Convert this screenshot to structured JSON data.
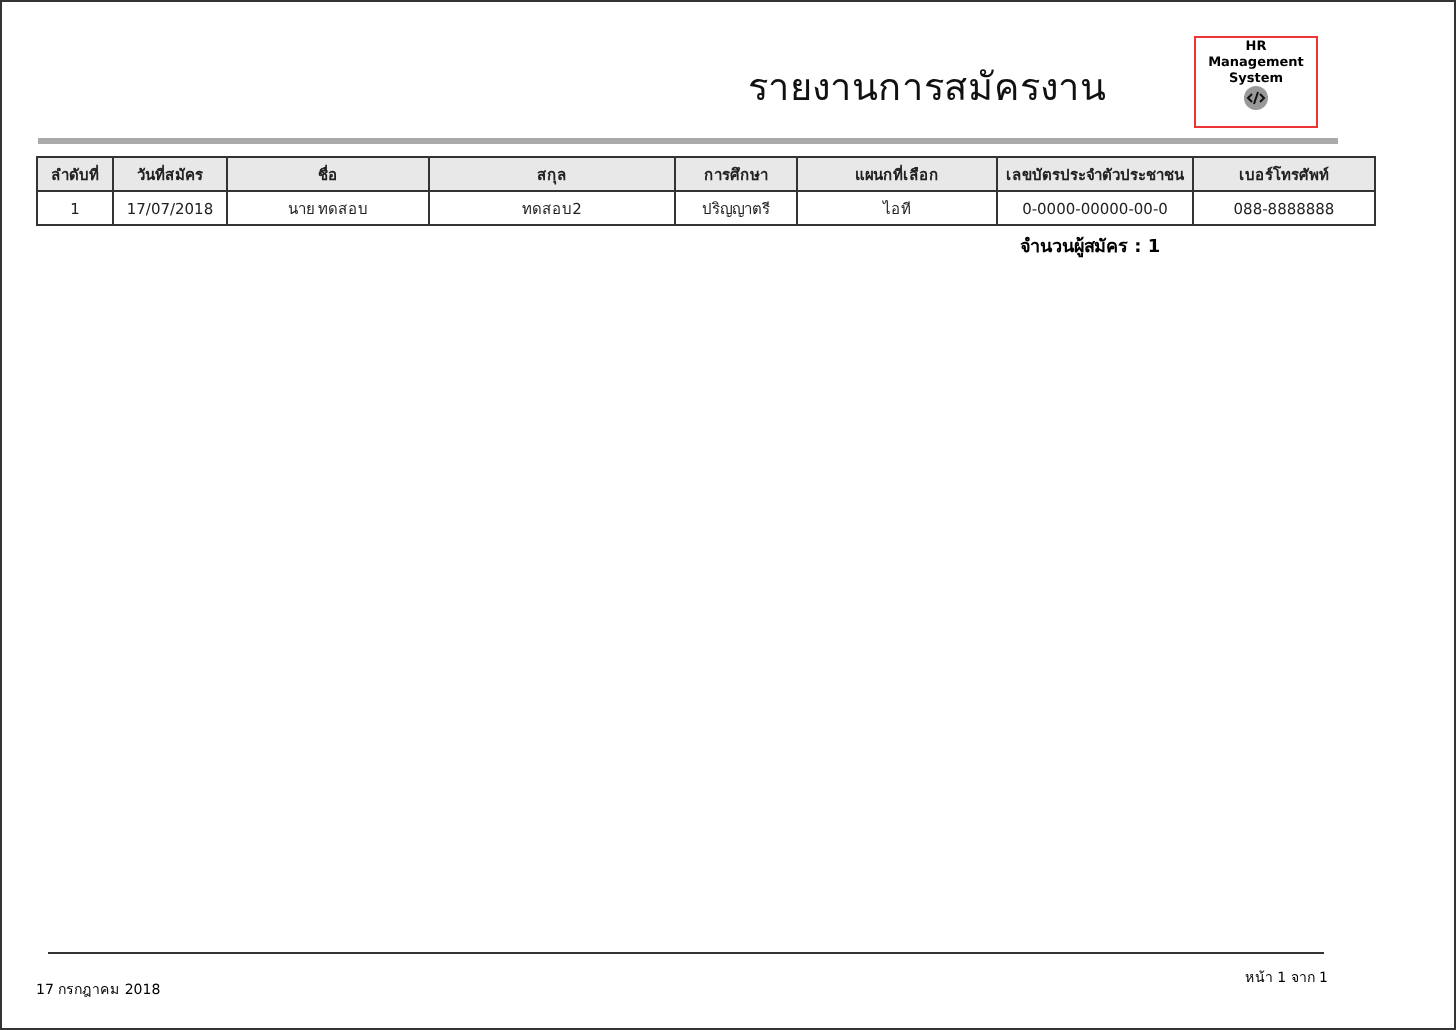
{
  "report": {
    "title": "รายงานการสมัครงาน",
    "logo": {
      "lines": [
        "HR",
        "Management",
        "System"
      ]
    }
  },
  "table": {
    "columns": [
      "ลำดับที่",
      "วันที่สมัคร",
      "ชื่อ",
      "สกุล",
      "การศึกษา",
      "แผนกที่เลือก",
      "เลขบัตรประจำตัวประชาชน",
      "เบอร์โทรศัพท์"
    ],
    "rows": [
      [
        "1",
        "17/07/2018",
        "นาย ทดสอบ",
        "ทดสอบ2",
        "ปริญญาตรี",
        "ไอที",
        "0-0000-00000-00-0",
        "088-8888888"
      ]
    ]
  },
  "summary": "จำนวนผู้สมัคร : 1",
  "footer": {
    "date": "17 กรกฎาคม 2018",
    "page": "หน้า 1 จาก 1"
  }
}
